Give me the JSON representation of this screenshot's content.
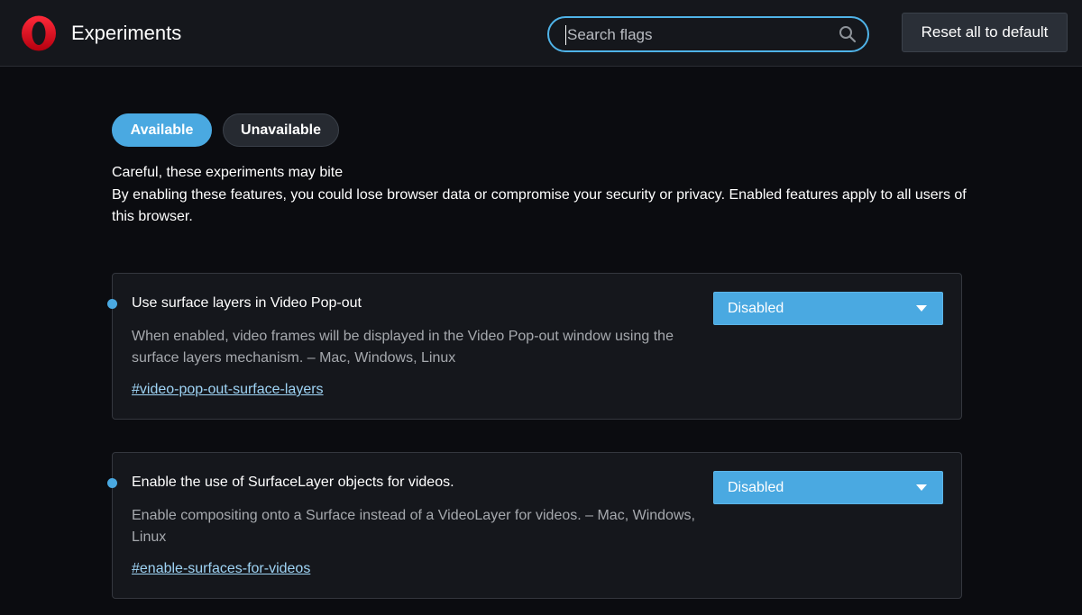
{
  "header": {
    "title": "Experiments",
    "search_placeholder": "Search flags",
    "search_value": "",
    "reset_label": "Reset all to default",
    "logo_icon": "opera-logo-icon",
    "search_icon": "search-icon"
  },
  "tabs": [
    {
      "label": "Available",
      "active": true
    },
    {
      "label": "Unavailable",
      "active": false
    }
  ],
  "warning": {
    "title": "Careful, these experiments may bite",
    "body": "By enabling these features, you could lose browser data or compromise your security or privacy. Enabled features apply to all users of this browser."
  },
  "flags": [
    {
      "name": "Use surface layers in Video Pop-out",
      "description": "When enabled, video frames will be displayed in the Video Pop-out window using the surface layers mechanism. – Mac, Windows, Linux",
      "link": "#video-pop-out-surface-layers",
      "value": "Disabled"
    },
    {
      "name": "Enable the use of SurfaceLayer objects for videos.",
      "description": "Enable compositing onto a Surface instead of a VideoLayer for videos. – Mac, Windows, Linux",
      "link": "#enable-surfaces-for-videos",
      "value": "Disabled"
    }
  ],
  "colors": {
    "accent": "#4aa9e1",
    "background": "#0b0c10",
    "header_bg": "#15171c",
    "link": "#9fd4f5",
    "opera_red": "#e0101e"
  }
}
